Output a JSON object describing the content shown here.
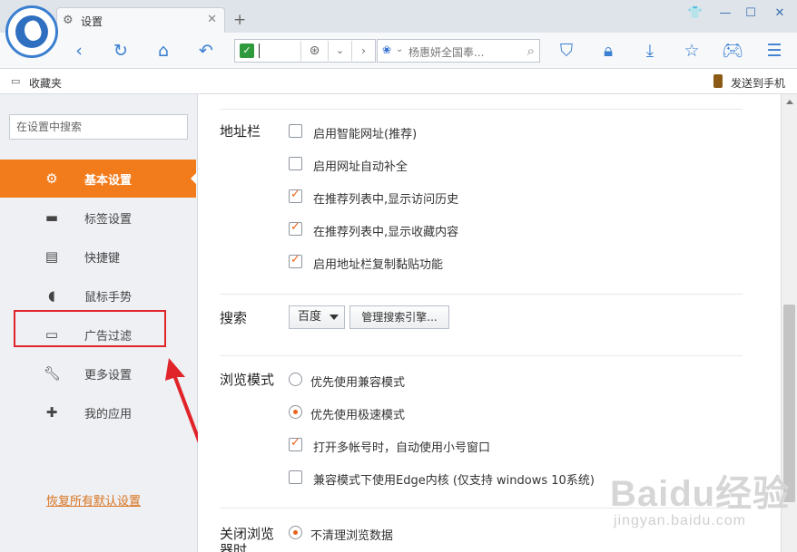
{
  "browser": {
    "tab_title": "设置",
    "search_text": "杨惠妍全国奉...",
    "accent": "#3a7fd0"
  },
  "bookmarks": {
    "folder_label": "收藏夹",
    "send_label": "发送到手机"
  },
  "sidebar": {
    "search_placeholder": "在设置中搜索",
    "items": [
      {
        "label": "基本设置",
        "icon": "gear-icon",
        "active": true
      },
      {
        "label": "标签设置",
        "icon": "laptop-icon"
      },
      {
        "label": "快捷键",
        "icon": "keyboard-icon"
      },
      {
        "label": "鼠标手势",
        "icon": "mouse-icon"
      },
      {
        "label": "广告过滤",
        "icon": "window-icon"
      },
      {
        "label": "更多设置",
        "icon": "wrench-icon"
      },
      {
        "label": "我的应用",
        "icon": "puzzle-icon"
      }
    ],
    "restore_label": "恢复所有默认设置",
    "active_color": "#f27b1c"
  },
  "content": {
    "address": {
      "title": "地址栏",
      "options": [
        {
          "label": "启用智能网址(推荐)",
          "checked": false
        },
        {
          "label": "启用网址自动补全",
          "checked": false
        },
        {
          "label": "在推荐列表中,显示访问历史",
          "checked": true
        },
        {
          "label": "在推荐列表中,显示收藏内容",
          "checked": true
        },
        {
          "label": "启用地址栏复制黏贴功能",
          "checked": true
        }
      ]
    },
    "search": {
      "title": "搜索",
      "engine": "百度",
      "manage_label": "管理搜索引擎..."
    },
    "browse": {
      "title": "浏览模式",
      "options": [
        {
          "label": "优先使用兼容模式",
          "type": "radio",
          "checked": false
        },
        {
          "label": "优先使用极速模式",
          "type": "radio",
          "checked": true
        },
        {
          "label": "打开多帐号时，自动使用小号窗口",
          "type": "checkbox",
          "checked": true
        },
        {
          "label": "兼容模式下使用Edge内核 (仅支持 windows 10系统)",
          "type": "checkbox",
          "checked": false
        }
      ]
    },
    "close": {
      "title": "关闭浏览器时",
      "option": "不清理浏览数据"
    }
  },
  "watermark": {
    "line1": "Baidu经验",
    "line2": "jingyan.baidu.com"
  }
}
